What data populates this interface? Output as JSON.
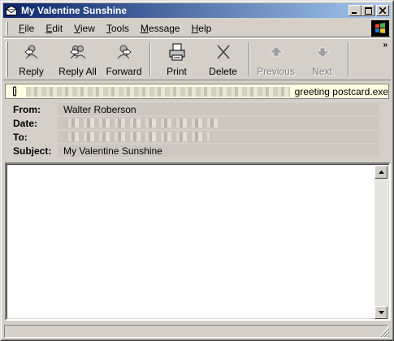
{
  "window": {
    "title": "My Valentine Sunshine"
  },
  "title_buttons": {
    "minimize": "_",
    "maximize": "□",
    "close": "×"
  },
  "menu": [
    {
      "pre": "",
      "ul": "F",
      "post": "ile"
    },
    {
      "pre": "",
      "ul": "E",
      "post": "dit"
    },
    {
      "pre": "",
      "ul": "V",
      "post": "iew"
    },
    {
      "pre": "",
      "ul": "T",
      "post": "ools"
    },
    {
      "pre": "",
      "ul": "M",
      "post": "essage"
    },
    {
      "pre": "",
      "ul": "H",
      "post": "elp"
    }
  ],
  "toolbar": {
    "reply": "Reply",
    "reply_all": "Reply All",
    "forward": "Forward",
    "print": "Print",
    "delete": "Delete",
    "previous": "Previous",
    "next": "Next",
    "more": "»"
  },
  "attachment": {
    "name": "greeting postcard.exe"
  },
  "headers": {
    "from_label": "From:",
    "from_value": "Walter Roberson",
    "date_label": "Date:",
    "to_label": "To:",
    "subject_label": "Subject:",
    "subject_value": "My Valentine Sunshine"
  },
  "colors": {
    "titlebar_start": "#0a246a",
    "titlebar_end": "#a6caf0",
    "attachment_bg": "#ffffe1",
    "window_bg": "#d4d0c8"
  }
}
